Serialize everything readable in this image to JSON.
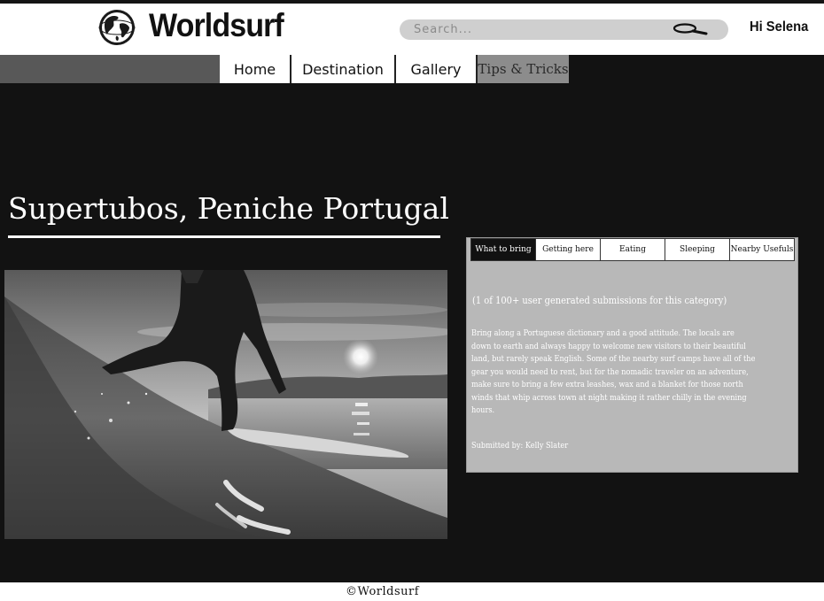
{
  "header": {
    "logo_text": "Worldsurf",
    "search_placeholder": "Search...",
    "greeting": "Hi Selena"
  },
  "nav": {
    "tabs": [
      {
        "label": "Home"
      },
      {
        "label": "Destination"
      },
      {
        "label": "Gallery"
      },
      {
        "label": "Tips & Tricks",
        "active": true
      }
    ]
  },
  "main": {
    "title": "Supertubos, Peniche Portugal"
  },
  "panel": {
    "tabs": [
      {
        "label": "What to bring",
        "active": true
      },
      {
        "label": "Getting here"
      },
      {
        "label": "Eating"
      },
      {
        "label": "Sleeping"
      },
      {
        "label": "Nearby Usefuls"
      }
    ],
    "count_text": "(1 of 100+ user generated submissions for this category)",
    "body_lines": [
      "Bring along a Portuguese dictionary and a good attitude. The locals are",
      "down to earth and always happy to welcome new visitors to their beautiful",
      "land, but rarely speak English. Some of the nearby surf camps have all of the",
      "gear you would need to rent, but for the nomadic traveler on an adventure,",
      "make sure to bring a few extra leashes, wax and a blanket for those north",
      "winds that whip across town at night making it rather chilly in the evening",
      "hours."
    ],
    "submitted_by": "Submitted by: Kelly Slater"
  },
  "footer": {
    "copyright": "©Worldsurf"
  },
  "colors": {
    "background": "#121212",
    "header_bg": "#ffffff",
    "panel_bg": "#b8b8b8",
    "active_nav_bg": "#8c8c8c",
    "search_bg": "#cfcfcf"
  }
}
